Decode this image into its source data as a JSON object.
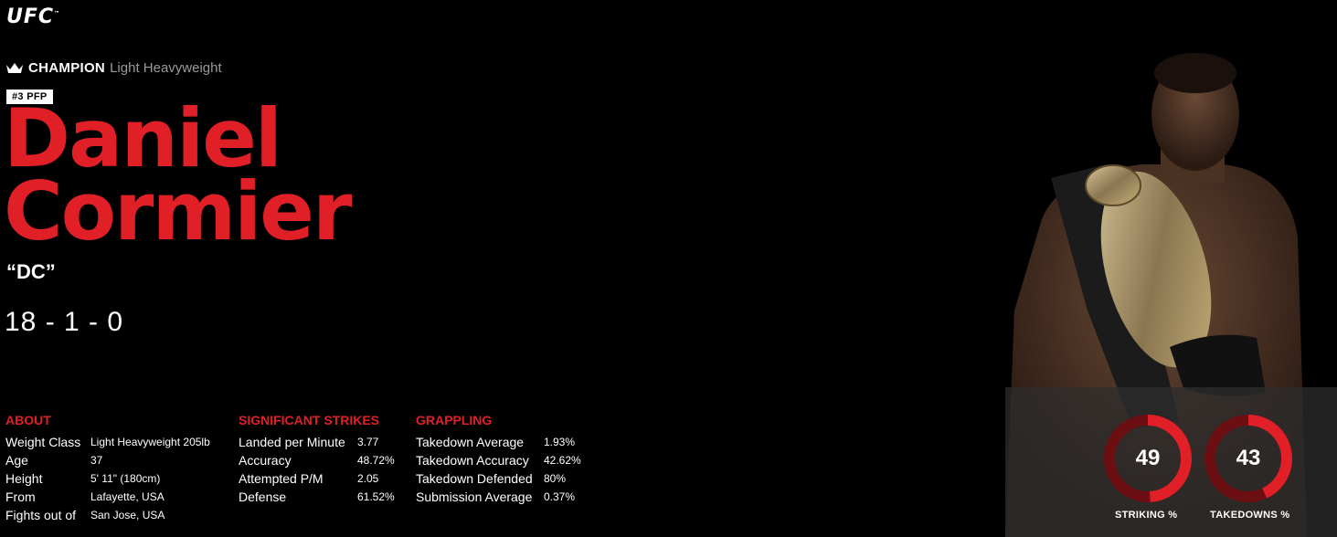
{
  "brand": {
    "logo": "UFC"
  },
  "header": {
    "champion_label": "CHAMPION",
    "division": "Light Heavyweight",
    "rank_badge": "#3 PFP",
    "first_name": "Daniel",
    "last_name": "Cormier",
    "nickname": "“DC”",
    "record": "18 - 1 - 0"
  },
  "about": {
    "title": "ABOUT",
    "rows": [
      {
        "label": "Weight Class",
        "value": "Light Heavyweight 205lb"
      },
      {
        "label": "Age",
        "value": "37"
      },
      {
        "label": "Height",
        "value": "5' 11\" (180cm)"
      },
      {
        "label": "From",
        "value": "Lafayette, USA"
      },
      {
        "label": "Fights out of",
        "value": "San Jose, USA"
      }
    ]
  },
  "strikes": {
    "title": "SIGNIFICANT STRIKES",
    "rows": [
      {
        "label": "Landed per Minute",
        "value": "3.77"
      },
      {
        "label": "Accuracy",
        "value": "48.72%"
      },
      {
        "label": "Attempted P/M",
        "value": "2.05"
      },
      {
        "label": "Defense",
        "value": "61.52%"
      }
    ]
  },
  "grappling": {
    "title": "GRAPPLING",
    "rows": [
      {
        "label": "Takedown Average",
        "value": "1.93%"
      },
      {
        "label": "Takedown Accuracy",
        "value": "42.62%"
      },
      {
        "label": "Takedown Defended",
        "value": "80%"
      },
      {
        "label": "Submission Average",
        "value": "0.37%"
      }
    ]
  },
  "rings": [
    {
      "value": "49",
      "fraction": 0.49,
      "label": "STRIKING %"
    },
    {
      "value": "43",
      "fraction": 0.43,
      "label": "TAKEDOWNS %"
    }
  ],
  "colors": {
    "accent": "#e11f27",
    "ring_track": "#6b0f12"
  },
  "icons": {
    "champion": "crown-icon"
  }
}
